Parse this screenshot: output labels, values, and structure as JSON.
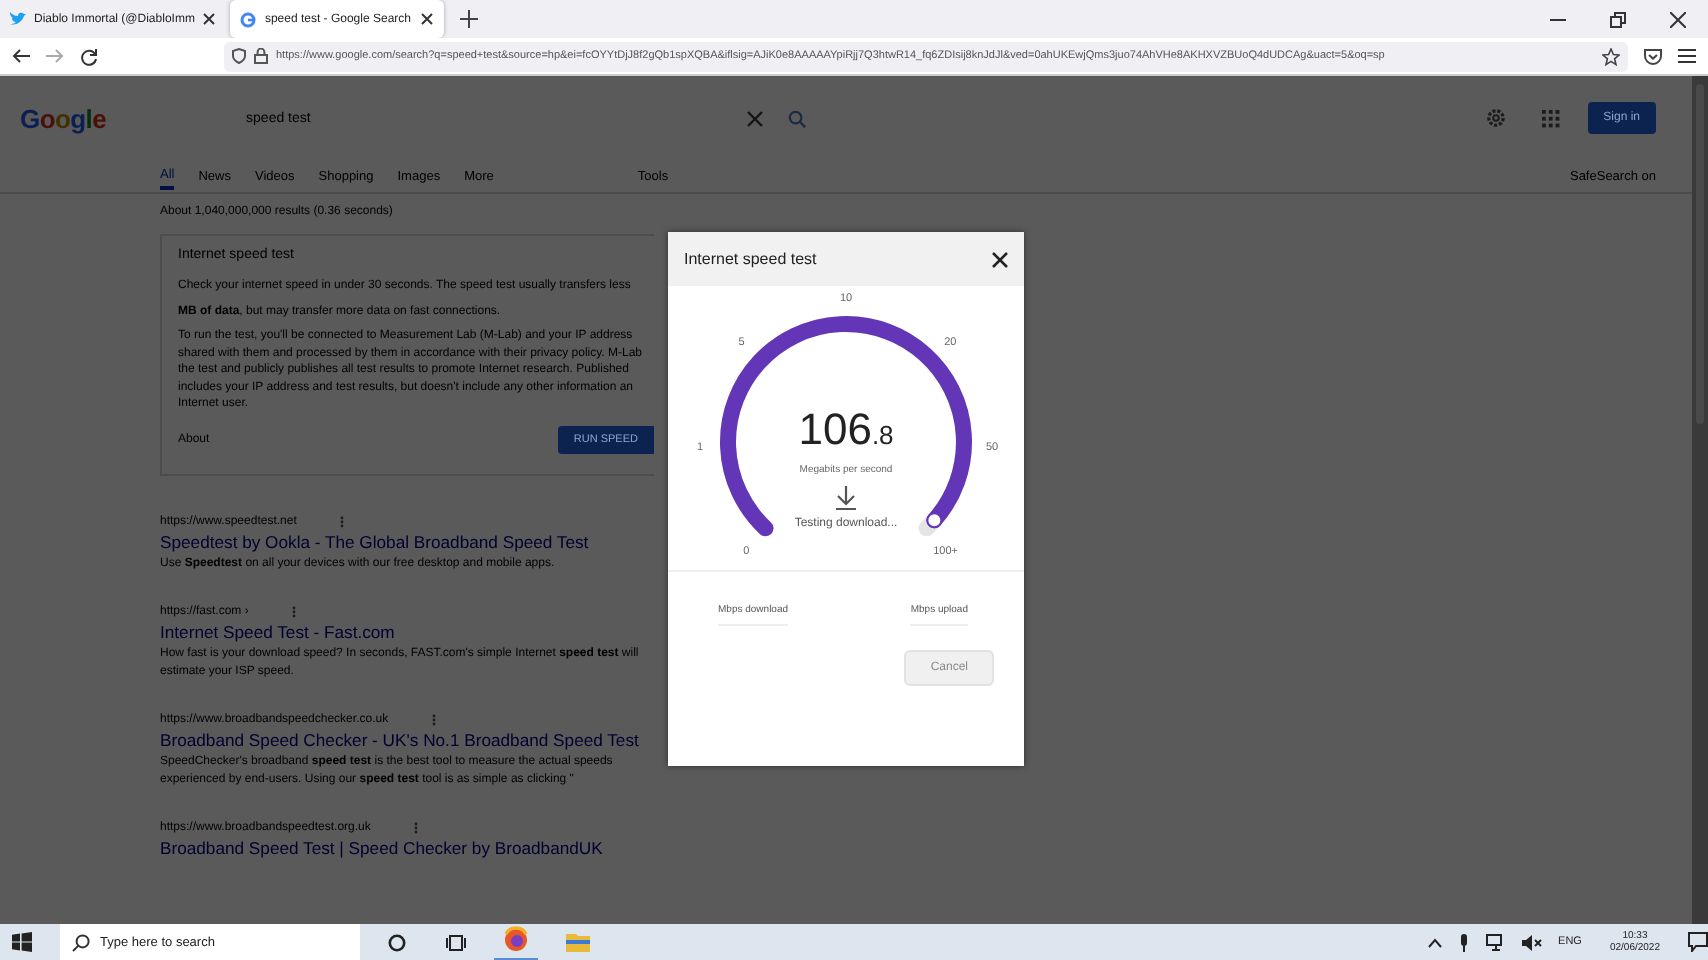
{
  "browser": {
    "tabs": [
      {
        "title": "Diablo Immortal (@DiabloImm",
        "selected": false
      },
      {
        "title": "speed test - Google Search",
        "selected": true
      }
    ],
    "url": "https://www.google.com/search?q=speed+test&source=hp&ei=fcOYYtDjJ8f2gQb1spXQBA&iflsig=AJiK0e8AAAAAYpiRjj7Q3htwR14_fq6ZDIsij8knJdJl&ved=0ahUKEwjQms3juo74AhVHe8AKHXVZBUoQ4dUDCAg&uact=5&oq=sp"
  },
  "page": {
    "logo": "Google",
    "query": "speed test",
    "sign_in": "Sign in",
    "tabs": [
      {
        "label": "All",
        "selected": true
      },
      {
        "label": "News",
        "selected": false
      },
      {
        "label": "Videos",
        "selected": false
      },
      {
        "label": "Shopping",
        "selected": false
      },
      {
        "label": "Images",
        "selected": false
      },
      {
        "label": "More",
        "selected": false
      }
    ],
    "tools": "Tools",
    "safesearch": "SafeSearch on",
    "result_stats": "About 1,040,000,000 results (0.36 seconds)",
    "speed_card": {
      "title": "Internet speed test",
      "paragraphs": [
        "Check your internet speed in under 30 seconds. The speed test usually transfers less",
        "**MB of data**, but may transfer more data on fast connections.",
        "To run the test, you'll be connected to Measurement Lab (M-Lab) and your IP address shared with them and processed by them in accordance with their privacy policy. M-Lab the test and publicly publishes all test results to promote Internet research. Published includes your IP address and test results, but doesn't include any other information an Internet user."
      ],
      "about": "About",
      "run_button": "RUN SPEED"
    },
    "results": [
      {
        "url": "https://www.speedtest.net",
        "title": "Speedtest by Ookla - The Global Broadband Speed Test",
        "snippet": "Use **Speedtest** on all your devices with our free desktop and mobile apps."
      },
      {
        "url": "https://fast.com ›",
        "title": "Internet Speed Test - Fast.com",
        "snippet": "How fast is your download speed? In seconds, FAST.com's simple Internet **speed test** will estimate your ISP speed."
      },
      {
        "url": "https://www.broadbandspeedchecker.co.uk",
        "title": "Broadband Speed Checker - UK's No.1 Broadband Speed Test",
        "snippet": "SpeedChecker's broadband **speed test** is the best tool to measure the actual speeds experienced by end-users. Using our **speed test** tool is as simple as clicking \""
      },
      {
        "url": "https://www.broadbandspeedtest.org.uk",
        "title": "Broadband Speed Test | Speed Checker by BroadbandUK"
      }
    ]
  },
  "dialog": {
    "title": "Internet speed test",
    "gauge": {
      "level": 0.98,
      "ticks": [
        "0",
        "1",
        "5",
        "10",
        "20",
        "50",
        "100+"
      ]
    },
    "speed_whole": "106",
    "speed_fraction": ".8",
    "unit": "Megabits per second",
    "status": "Testing download...",
    "download_label": "Mbps download",
    "upload_label": "Mbps upload",
    "cancel": {
      "label": "Cancel",
      "disabled": true
    }
  },
  "taskbar": {
    "search_placeholder": "Type here to search",
    "language": "ENG",
    "time": "10:33",
    "date": "02/06/2022"
  }
}
